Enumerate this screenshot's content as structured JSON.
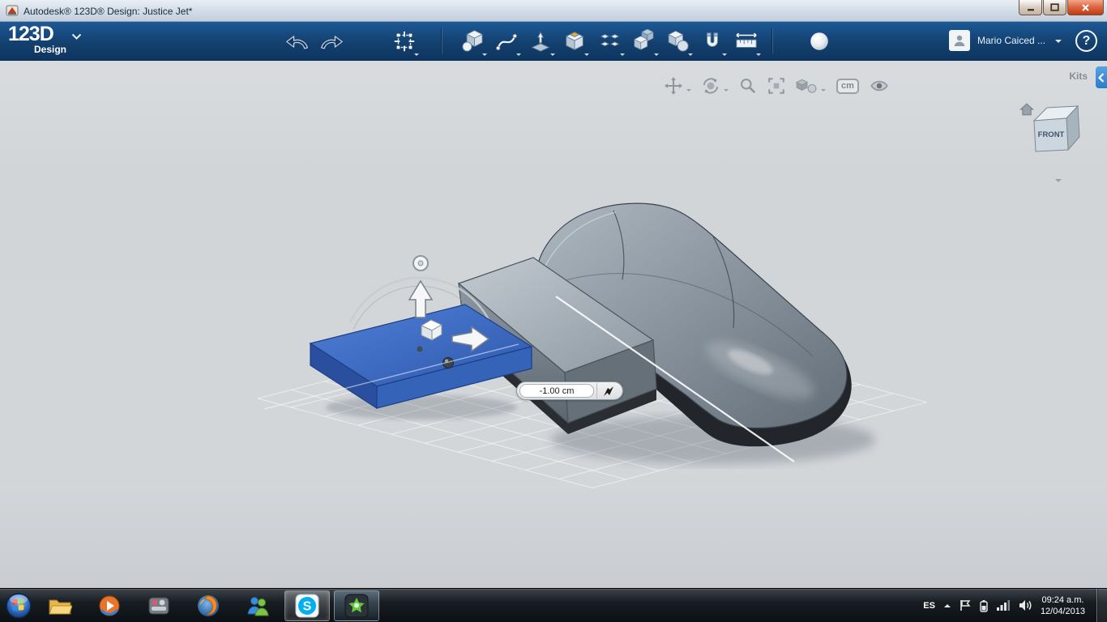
{
  "window": {
    "title": "Autodesk® 123D® Design: Justice Jet*"
  },
  "appbar": {
    "logo": "123D",
    "logo_sub": "Design",
    "tools": [
      "undo",
      "redo",
      "transform",
      "primitives",
      "sketch",
      "construct",
      "modify",
      "pattern",
      "group",
      "combine",
      "snap",
      "measure",
      "material"
    ],
    "user_name": "Mario Caiced ...",
    "help": "?"
  },
  "viewport": {
    "kits_label": "Kits",
    "nav_tools": [
      "pan",
      "orbit",
      "zoom",
      "fit",
      "display-settings",
      "units",
      "visibility"
    ],
    "unit_label": "cm",
    "viewcube_front": "FRONT",
    "dimension_value": "-1.00 cm",
    "selection_color": "#3a67be"
  },
  "taskbar": {
    "skype_letter": "S",
    "pinned_apps": [
      "explorer",
      "media-player",
      "media-app",
      "firefox",
      "messenger",
      "skype",
      "123d-design"
    ],
    "tray": {
      "language": "ES",
      "time": "09:24 a.m.",
      "date": "12/04/2013"
    }
  },
  "colors": {
    "appbar_blue": "#13406f",
    "panel_accent": "#2b7ccd",
    "model_gray": "#7d8892"
  }
}
